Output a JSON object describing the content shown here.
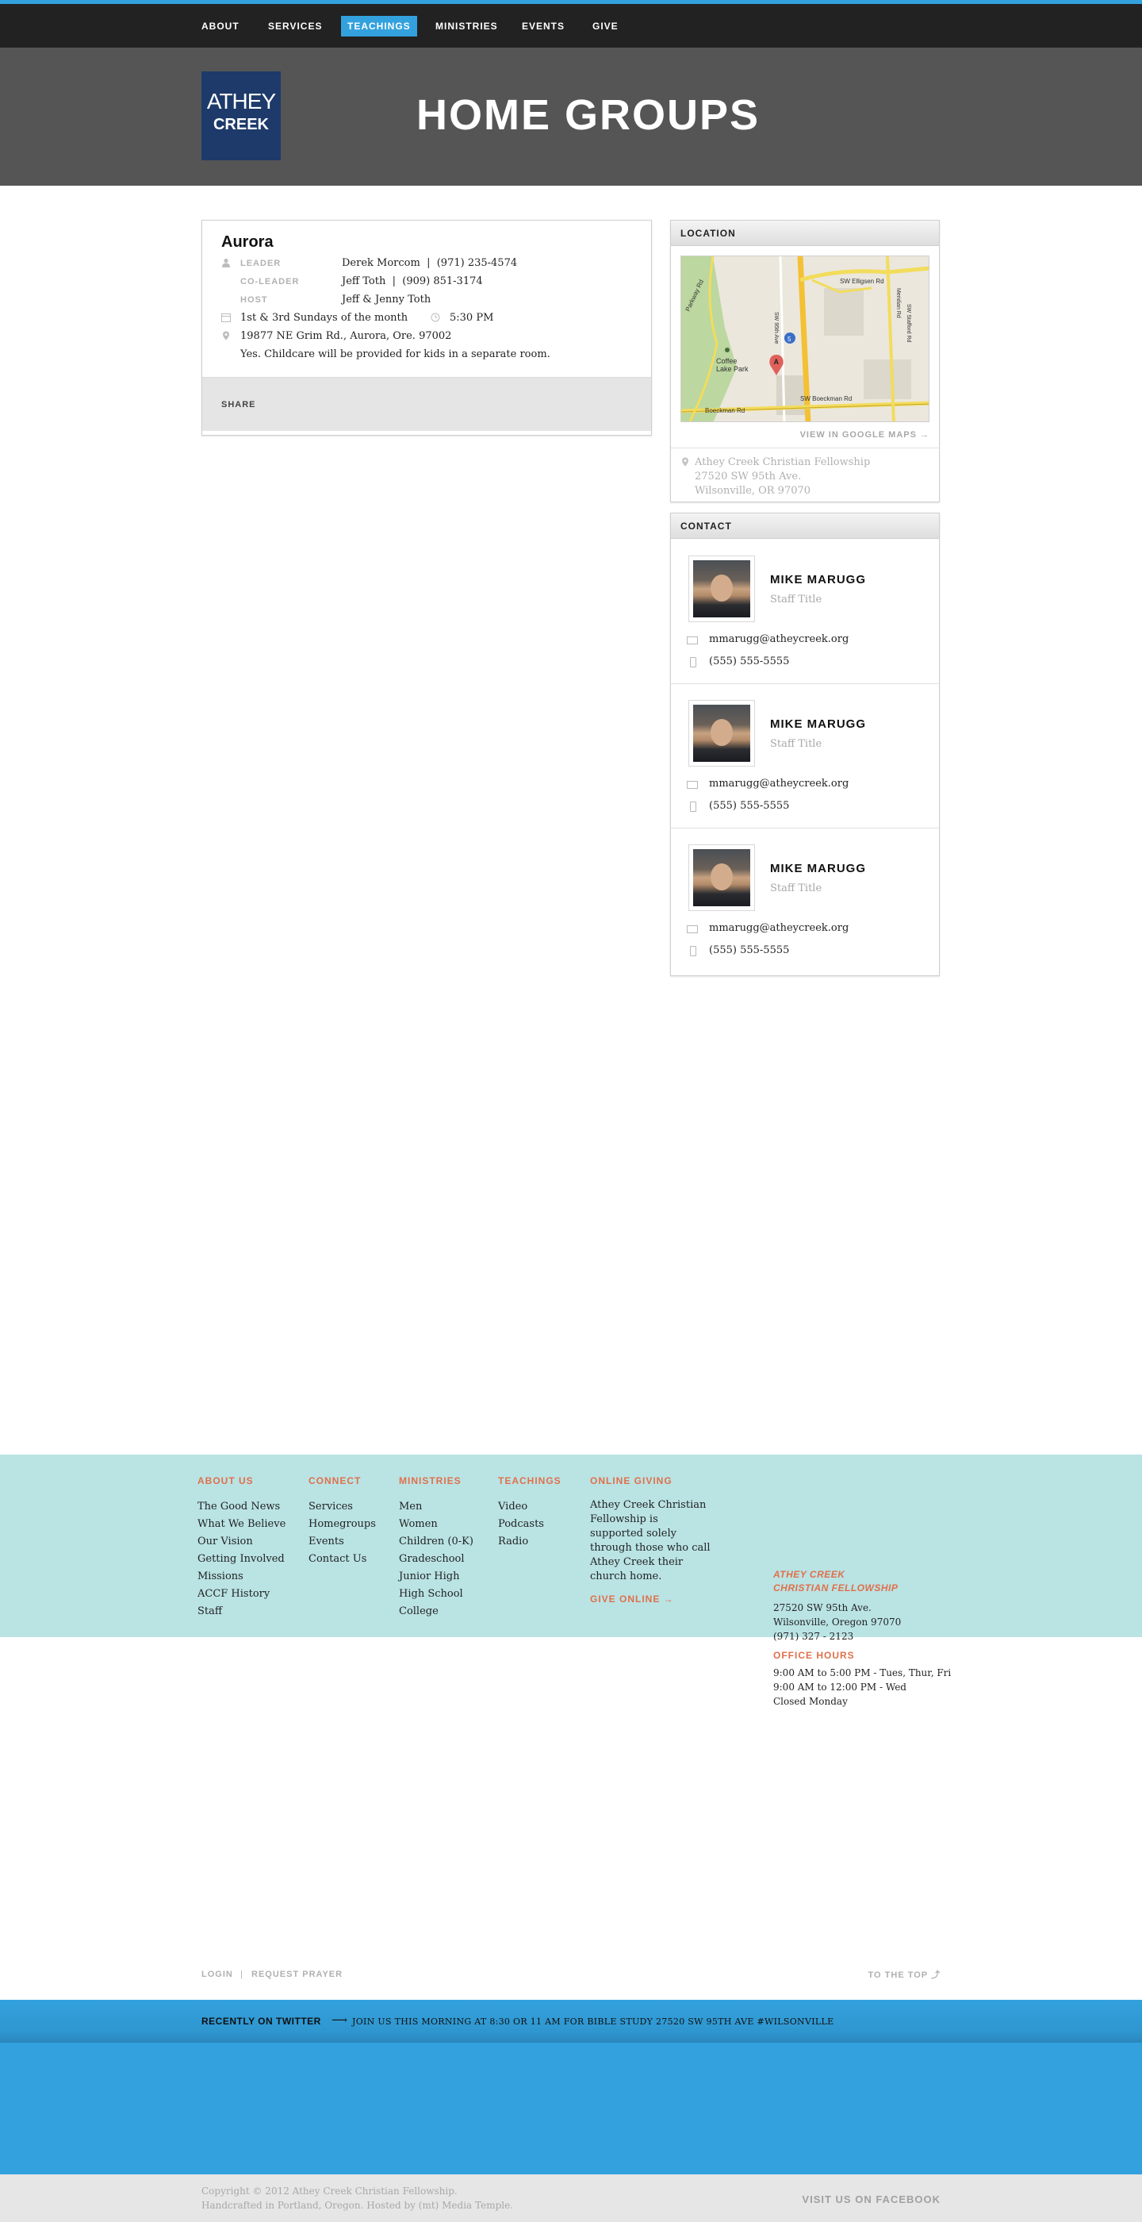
{
  "nav": {
    "items": [
      {
        "label": "ABOUT",
        "active": false
      },
      {
        "label": "SERVICES",
        "active": false
      },
      {
        "label": "TEACHINGS",
        "active": true
      },
      {
        "label": "MINISTRIES",
        "active": false
      },
      {
        "label": "EVENTS",
        "active": false
      },
      {
        "label": "GIVE",
        "active": false
      }
    ]
  },
  "logo": {
    "line1": "ATHEY",
    "line2": "CREEK"
  },
  "page_title": "HOME GROUPS",
  "group": {
    "name": "Aurora",
    "leader_label": "LEADER",
    "leader": "Derek Morcom  |  (971) 235-4574",
    "coleader_label": "CO-LEADER",
    "coleader": "Jeff Toth  |  (909) 851-3174",
    "host_label": "HOST",
    "host": "Jeff & Jenny Toth",
    "schedule": "1st & 3rd Sundays of the month",
    "time": "5:30 PM",
    "address": "19877 NE Grim Rd., Aurora, Ore. 97002",
    "childcare": "Yes. Childcare will be provided for kids in a separate room.",
    "share_label": "SHARE"
  },
  "location": {
    "heading": "LOCATION",
    "map_labels": {
      "road1": "SW Elligsen Rd",
      "road2": "Parkway Rd",
      "road3": "SW Boeckman Rd",
      "road4": "Boeckman Rd",
      "road5": "SW 95th Ave",
      "road6": "SW Stafford Rd",
      "road7": "Meridian Rd",
      "park": "Coffee\nLake Park",
      "marker": "A",
      "shield": "5"
    },
    "gmaps_link": "VIEW IN GOOGLE MAPS →",
    "address_lines": [
      "Athey Creek Christian Fellowship",
      "27520 SW 95th Ave.",
      "Wilsonville, OR 97070"
    ]
  },
  "contact": {
    "heading": "CONTACT",
    "people": [
      {
        "name": "MIKE MARUGG",
        "title": "Staff Title",
        "email": "mmarugg@atheycreek.org",
        "phone": "(555) 555-5555"
      },
      {
        "name": "MIKE MARUGG",
        "title": "Staff Title",
        "email": "mmarugg@atheycreek.org",
        "phone": "(555) 555-5555"
      },
      {
        "name": "MIKE MARUGG",
        "title": "Staff Title",
        "email": "mmarugg@atheycreek.org",
        "phone": "(555) 555-5555"
      }
    ]
  },
  "footer": {
    "about": {
      "heading": "ABOUT US",
      "links": [
        "The Good News",
        "What We Believe",
        "Our Vision",
        "Getting Involved",
        "Missions",
        "ACCF History",
        "Staff"
      ]
    },
    "connect": {
      "heading": "CONNECT",
      "links": [
        "Services",
        "Homegroups",
        "Events",
        "Contact Us"
      ]
    },
    "ministries": {
      "heading": "MINISTRIES",
      "links": [
        "Men",
        "Women",
        "Children (0-K)",
        "Gradeschool",
        "Junior High",
        "High School",
        "College"
      ]
    },
    "teachings": {
      "heading": "TEACHINGS",
      "links": [
        "Video",
        "Podcasts",
        "Radio"
      ]
    },
    "giving": {
      "heading": "ONLINE GIVING",
      "text": "Athey Creek Christian Fellowship is supported solely through those who call Athey Creek their church home.",
      "link": "GIVE ONLINE →"
    },
    "church": {
      "name_line1": "ATHEY CREEK",
      "name_line2": "CHRISTIAN FELLOWSHIP",
      "address1": "27520 SW 95th Ave.",
      "address2": "Wilsonville, Oregon 97070",
      "phone": "(971) 327 - 2123",
      "office_heading": "OFFICE HOURS",
      "hours": [
        "9:00 AM to 5:00 PM - Tues, Thur, Fri",
        "9:00 AM to 12:00 PM - Wed",
        "Closed Monday"
      ]
    }
  },
  "utility": {
    "login": "LOGIN",
    "separator": "|",
    "prayer": "REQUEST PRAYER",
    "to_top": "TO THE TOP ⤴"
  },
  "twitter": {
    "label": "RECENTLY ON TWITTER",
    "arrow": "⟶",
    "tweet": "JOIN US THIS MORNING AT 8:30 OR 11 AM FOR BIBLE STUDY 27520 SW 95TH AVE #WILSONVILLE"
  },
  "copyright": {
    "line1": "Copyright © 2012 Athey Creek Christian Fellowship.",
    "line2": "Handcrafted in Portland, Oregon. Hosted by (mt) Media Temple.",
    "facebook": "VISIT US ON FACEBOOK"
  },
  "colors": {
    "accent": "#33a1de",
    "nav_bg": "#222222",
    "hero_bg": "#555555",
    "footer_bg": "#bae3e4",
    "footer_accent": "#e0704a",
    "logo_bg": "#1d3a6a"
  }
}
